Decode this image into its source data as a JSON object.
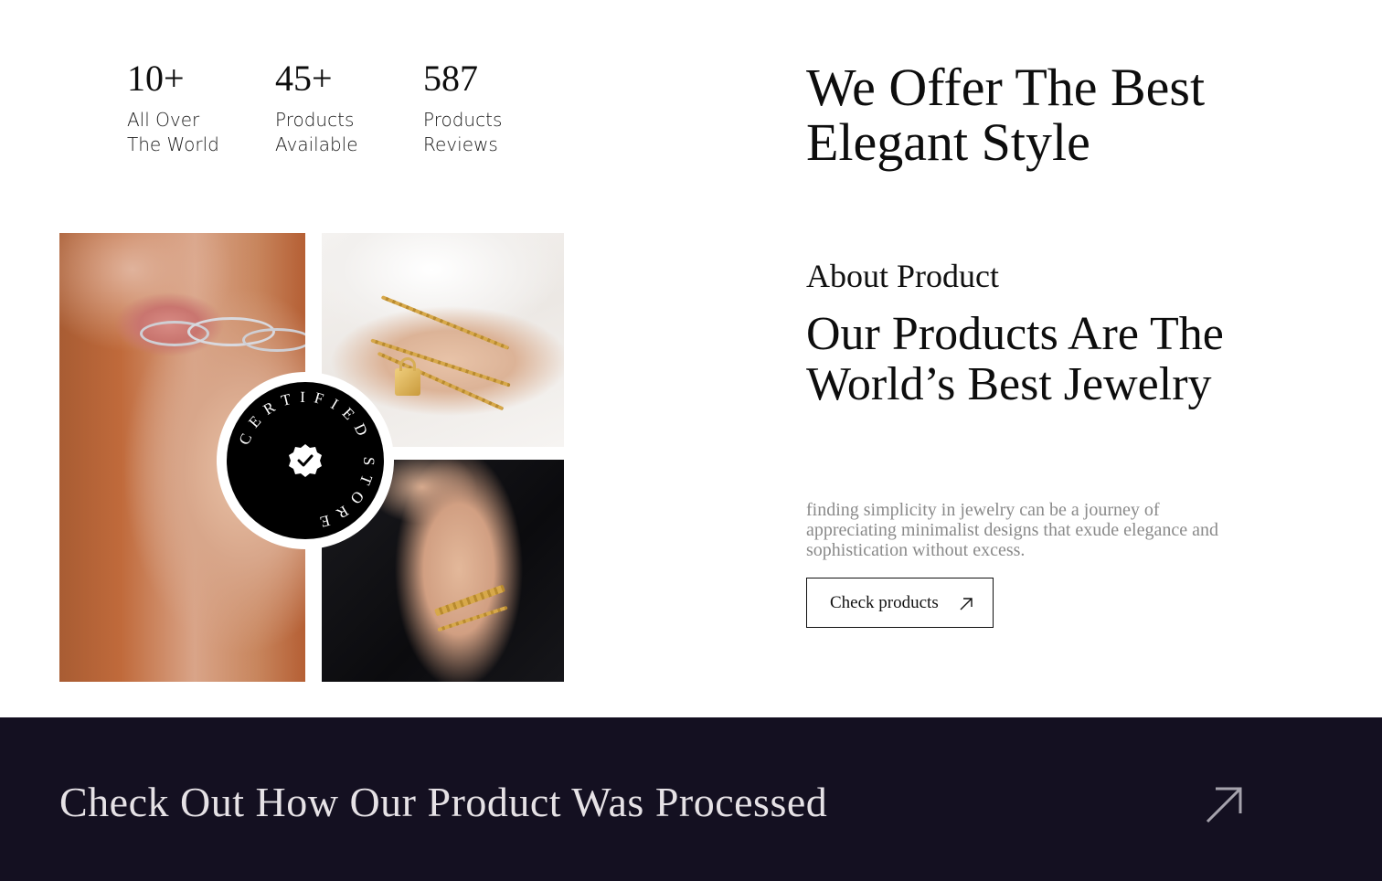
{
  "stats": [
    {
      "number": "10+",
      "label": "All Over\nThe World"
    },
    {
      "number": "45+",
      "label": "Products\nAvailable"
    },
    {
      "number": "587",
      "label": "Products\nReviews"
    }
  ],
  "hero": {
    "headline": "We Offer The Best Elegant Style"
  },
  "badge": {
    "text": "CERTIFIED STORE",
    "icon": "verified-check-icon"
  },
  "about": {
    "label": "About Product",
    "title": "Our Products Are The World’s Best Jewelry",
    "description": "finding simplicity in jewelry can be a journey of appreciating minimalist designs that exude elegance and sophistication without excess.",
    "cta_label": "Check products",
    "cta_icon": "arrow-up-right-icon"
  },
  "banner": {
    "title": "Check Out How Our Product Was Processed",
    "icon": "arrow-up-right-icon"
  },
  "colors": {
    "banner_bg": "#141021",
    "banner_text": "#e6e2e6",
    "description_text": "#8a8a8a"
  }
}
